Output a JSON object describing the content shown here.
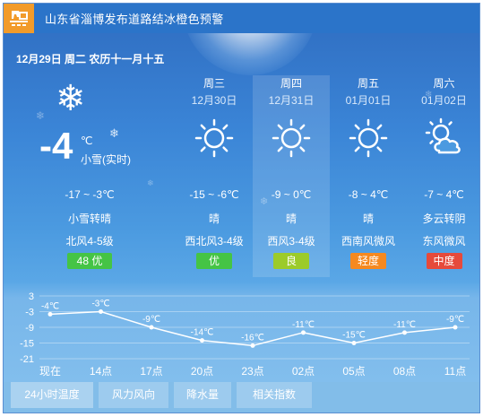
{
  "title": "山东省淄博发布道路结冰橙色预警",
  "date_line": "12月29日 周二 农历十一月十五",
  "today": {
    "icon": "snowflake-icon",
    "temp": "-4",
    "unit": "℃",
    "sub": "小雪(实时)",
    "range": "-17 ~ -3℃",
    "condition": "小雪转晴",
    "wind": "北风4-5级",
    "aqi": "48 优",
    "aqi_color": "#45c445"
  },
  "forecast": [
    {
      "day": "周三",
      "date": "12月30日",
      "icon": "sun-icon",
      "range": "-15 ~ -6℃",
      "condition": "晴",
      "wind": "西北风3-4级",
      "aqi": "优",
      "aqi_color": "#45c445"
    },
    {
      "day": "周四",
      "date": "12月31日",
      "icon": "sun-icon",
      "range": "-9 ~ 0℃",
      "condition": "晴",
      "wind": "西风3-4级",
      "aqi": "良",
      "aqi_color": "#9ccb2a"
    },
    {
      "day": "周五",
      "date": "01月01日",
      "icon": "sun-icon",
      "range": "-8 ~ 4℃",
      "condition": "晴",
      "wind": "西南风微风",
      "aqi": "轻度",
      "aqi_color": "#f5891f"
    },
    {
      "day": "周六",
      "date": "01月02日",
      "icon": "partly-cloudy-icon",
      "range": "-7 ~ 4℃",
      "condition": "多云转阴",
      "wind": "东风微风",
      "aqi": "中度",
      "aqi_color": "#e64a3b"
    }
  ],
  "tabs": [
    "24小时温度",
    "风力风向",
    "降水量",
    "相关指数"
  ],
  "chart_data": {
    "type": "line",
    "x": [
      "现在",
      "14点",
      "17点",
      "20点",
      "23点",
      "02点",
      "05点",
      "08点",
      "11点"
    ],
    "values": [
      -4,
      -3,
      -9,
      -14,
      -16,
      -11,
      -15,
      -11,
      -9
    ],
    "value_labels": [
      "-4℃",
      "-3℃",
      "-9℃",
      "-14℃",
      "-16℃",
      "-11℃",
      "-15℃",
      "-11℃",
      "-9℃"
    ],
    "yticks": [
      3,
      -3,
      -9,
      -15,
      -21
    ],
    "ylim": [
      -21,
      3
    ],
    "grid": true
  }
}
